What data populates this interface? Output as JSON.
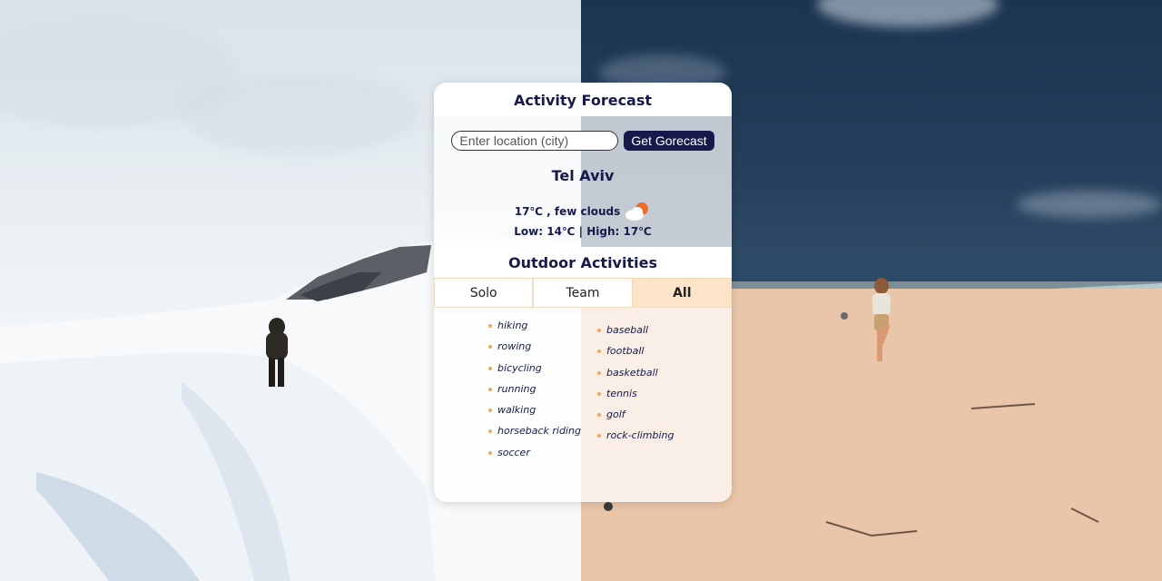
{
  "card": {
    "title": "Activity Forecast",
    "search": {
      "placeholder": "Enter location (city)",
      "value": "",
      "button_label": "Get Gorecast"
    },
    "weather": {
      "city": "Tel Aviv",
      "current": "17℃ , few clouds",
      "range": "Low: 14℃ | High: 17℃",
      "icon": "few-clouds-icon"
    },
    "activities": {
      "title": "Outdoor Activities",
      "tabs": [
        {
          "label": "Solo",
          "active": false
        },
        {
          "label": "Team",
          "active": false
        },
        {
          "label": "All",
          "active": true
        }
      ],
      "solo": [
        "hiking",
        "rowing",
        "bicycling",
        "running",
        "walking",
        "horseback riding",
        "soccer"
      ],
      "team": [
        "baseball",
        "football",
        "basketball",
        "tennis",
        "golf",
        "rock-climbing"
      ]
    }
  },
  "colors": {
    "accent": "#161a4a",
    "active_tab": "#fbe4c8",
    "bullet": "#f0a85a"
  }
}
